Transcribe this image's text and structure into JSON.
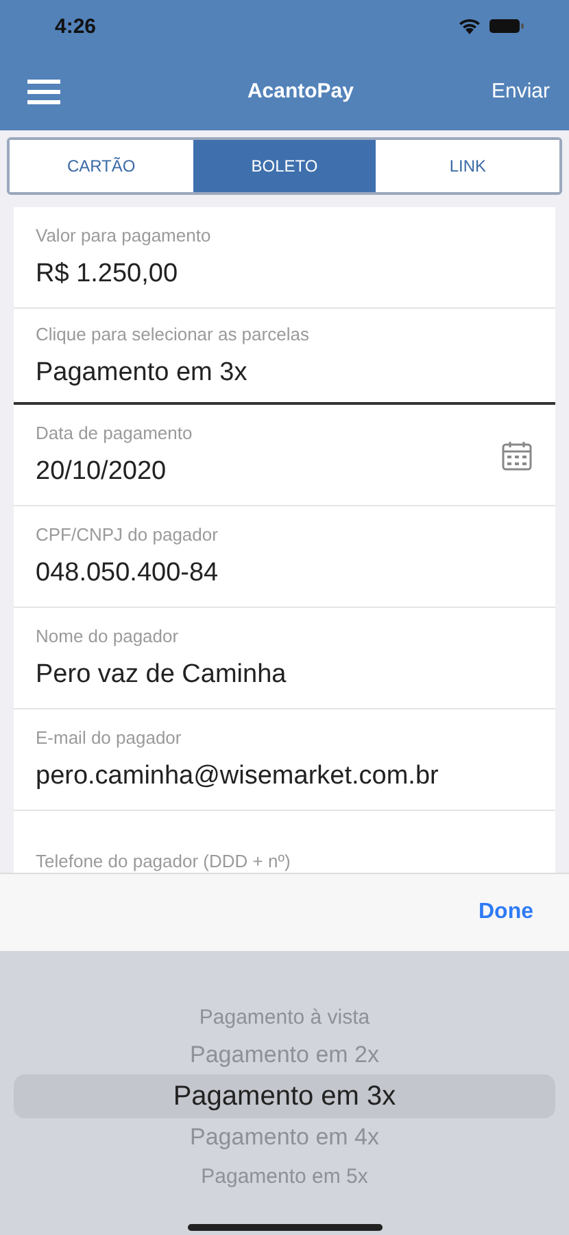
{
  "status_bar": {
    "time": "4:26"
  },
  "nav": {
    "title": "AcantoPay",
    "action": "Enviar"
  },
  "tabs": [
    {
      "label": "CARTÃO",
      "selected": false
    },
    {
      "label": "BOLETO",
      "selected": true
    },
    {
      "label": "LINK",
      "selected": false
    }
  ],
  "fields": [
    {
      "kind": "text",
      "label": "Valor para pagamento",
      "value": "R$ 1.250,00"
    },
    {
      "kind": "picker",
      "label": "Clique para selecionar as parcelas",
      "value": "Pagamento em 3x"
    },
    {
      "kind": "date",
      "label": "Data de pagamento",
      "value": "20/10/2020"
    },
    {
      "kind": "text",
      "label": "CPF/CNPJ do pagador",
      "value": "048.050.400-84"
    },
    {
      "kind": "text",
      "label": "Nome do pagador",
      "value": "Pero vaz de Caminha"
    },
    {
      "kind": "text",
      "label": "E-mail do pagador",
      "value": "pero.caminha@wisemarket.com.br"
    },
    {
      "kind": "text",
      "label": "Telefone do pagador (DDD + nº)"
    }
  ],
  "toolbar": {
    "done": "Done"
  },
  "picker": [
    {
      "label": "Pagamento à vista",
      "selected": false
    },
    {
      "label": "Pagamento em 2x",
      "selected": false
    },
    {
      "label": "Pagamento em 3x",
      "selected": true
    },
    {
      "label": "Pagamento em 4x",
      "selected": false
    },
    {
      "label": "Pagamento em 5x",
      "selected": false
    }
  ]
}
